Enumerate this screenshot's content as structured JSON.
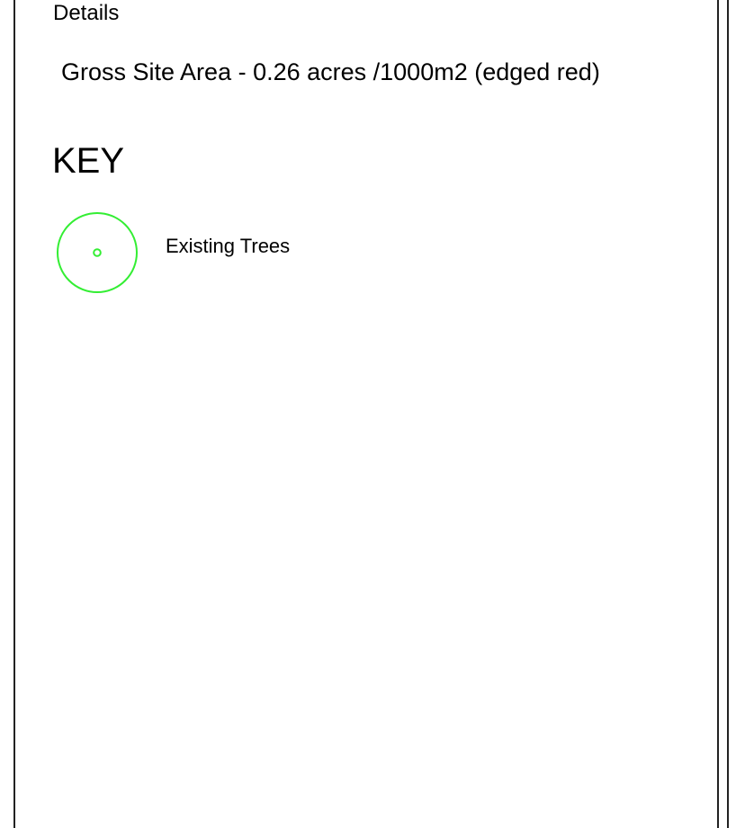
{
  "details": {
    "heading": "Details",
    "site_area": "Gross Site Area - 0.26 acres /1000m2 (edged red)"
  },
  "key": {
    "heading": "KEY",
    "items": [
      {
        "label": "Existing Trees",
        "icon": "tree-circle-icon",
        "color": "#33ee33"
      }
    ]
  }
}
